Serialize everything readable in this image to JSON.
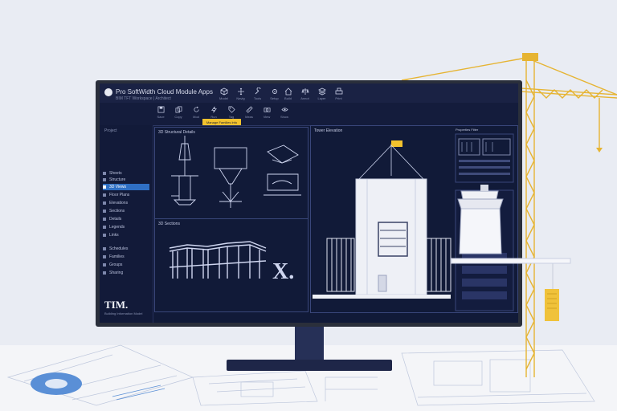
{
  "app": {
    "title": "Pro SoftWidth Cloud Module Apps",
    "subtitle": "BIM TFT Workspace | Architect",
    "logo_initial": "e"
  },
  "toolbar": {
    "groups": [
      {
        "tools": [
          {
            "icon": "cube-icon",
            "label": "Model"
          },
          {
            "icon": "pan-icon",
            "label": "Navig"
          },
          {
            "icon": "wrench-icon",
            "label": "Tools"
          },
          {
            "icon": "gear-icon",
            "label": "Setup"
          }
        ]
      },
      {
        "tools": [
          {
            "icon": "house-icon",
            "label": "Build"
          },
          {
            "icon": "scale-icon",
            "label": "Annot"
          },
          {
            "icon": "layers-icon",
            "label": "Layer"
          },
          {
            "icon": "print-icon",
            "label": "Print"
          }
        ]
      }
    ],
    "row2": [
      {
        "icon": "save-icon",
        "label": "Save"
      },
      {
        "icon": "copy-icon",
        "label": "Copy"
      },
      {
        "icon": "rotate-icon",
        "label": "Mod"
      },
      {
        "icon": "bolt-icon",
        "label": "Run"
      },
      {
        "icon": "tag-icon",
        "label": "Tag"
      },
      {
        "icon": "ruler-icon",
        "label": "Meas"
      },
      {
        "icon": "camera-icon",
        "label": "View"
      },
      {
        "icon": "eye-icon",
        "label": "Show"
      }
    ],
    "highlight_tab": "Manage Families Info",
    "highlight_color": "#f2c22e"
  },
  "sidebar": {
    "header": "Project",
    "items": [
      {
        "label": "Sheets",
        "active": false
      },
      {
        "label": "Structure",
        "active": false
      },
      {
        "label": "3D Views",
        "active": true
      },
      {
        "label": "Floor Plans",
        "active": false
      },
      {
        "label": "Elevations",
        "active": false
      },
      {
        "label": "Sections",
        "active": false
      },
      {
        "label": "Details",
        "active": false
      },
      {
        "label": "Legends",
        "active": false
      },
      {
        "label": "Links",
        "active": false
      },
      {
        "label": "Schedules",
        "active": false
      },
      {
        "label": "Families",
        "active": false
      },
      {
        "label": "Groups",
        "active": false
      },
      {
        "label": "Sharing",
        "active": false
      }
    ],
    "brand": "TIM.",
    "brand_sub": "Building Information Model"
  },
  "viewports": {
    "top_left_label": "3D Structural Details",
    "bottom_left_label": "3D Sections",
    "right_label": "Tower Elevation",
    "right_tabs": [
      "Properties Filter"
    ],
    "accent_flag": "#f2c22e"
  },
  "colors": {
    "screen_bg": "#111a38",
    "line": "#cfd6f0",
    "accent": "#f2c22e",
    "active": "#2f6fc4"
  }
}
